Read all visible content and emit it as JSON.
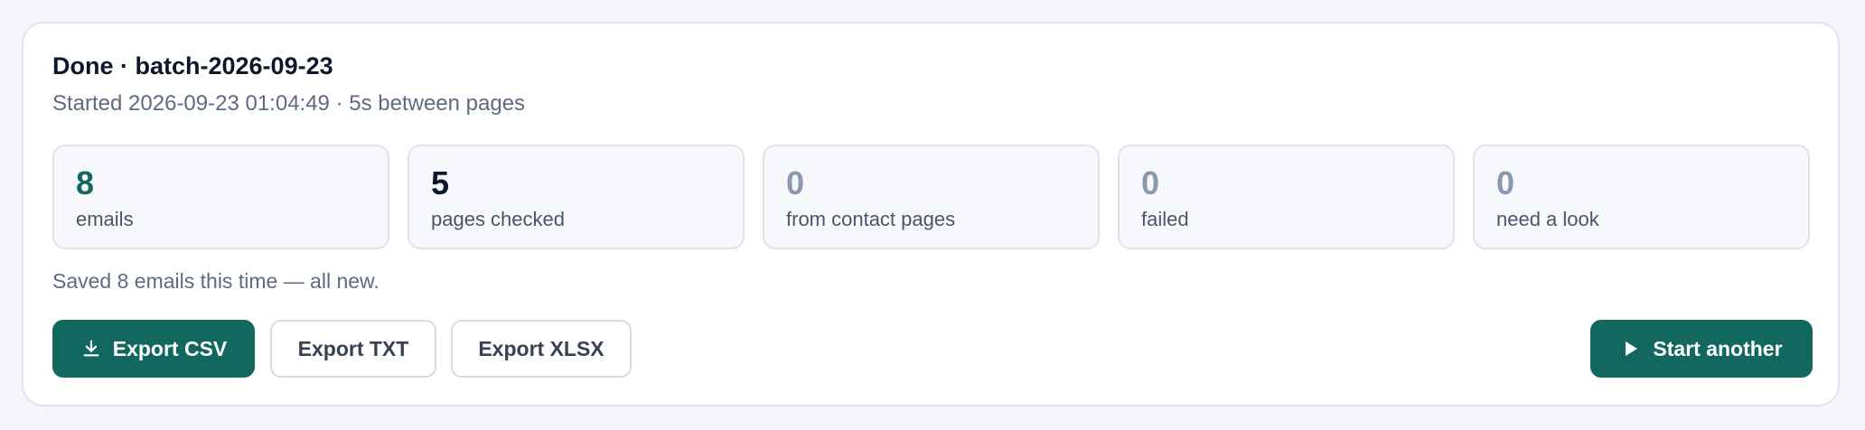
{
  "run": {
    "title": "Done · batch-2026-09-23",
    "subtitle": "Started 2026-09-23 01:04:49 · 5s between pages"
  },
  "stats": [
    {
      "value": "8",
      "label": "emails"
    },
    {
      "value": "5",
      "label": "pages checked"
    },
    {
      "value": "0",
      "label": "from contact pages"
    },
    {
      "value": "0",
      "label": "failed"
    },
    {
      "value": "0",
      "label": "need a look"
    }
  ],
  "summary": {
    "saved_note": "Saved 8 emails this time — all new."
  },
  "actions": {
    "export_csv": "Export CSV",
    "export_txt": "Export TXT",
    "export_xlsx": "Export XLSX",
    "start_another": "Start another"
  },
  "icons": {
    "export_csv": "download-icon",
    "start_another": "play-icon"
  },
  "colors": {
    "accent": "#12685f",
    "muted_value": "#8b99b0"
  }
}
